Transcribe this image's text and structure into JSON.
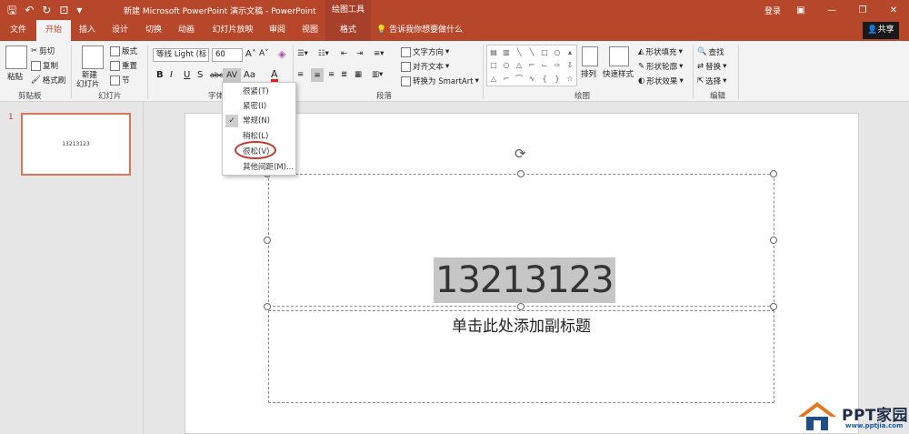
{
  "titlebar": {
    "qat_icons": [
      "save-icon",
      "undo-icon",
      "redo-icon",
      "start-from-beginning-icon",
      "customize-qat-icon"
    ],
    "title": "新建 Microsoft PowerPoint 演示文稿 - PowerPoint",
    "context_tab_title": "绘图工具",
    "login": "登录"
  },
  "tabs": [
    "文件",
    "开始",
    "插入",
    "设计",
    "切换",
    "动画",
    "幻灯片放映",
    "审阅",
    "视图",
    "格式"
  ],
  "tellme": "告诉我你想要做什么",
  "share": "共享",
  "ribbon": {
    "clipboard": {
      "paste": "粘贴",
      "cut": "剪切",
      "copy": "复制",
      "format_painter": "格式刷",
      "label": "剪贴板"
    },
    "slides": {
      "new_slide_line1": "新建",
      "new_slide_line2": "幻灯片",
      "layout": "版式",
      "reset": "重置",
      "section": "节",
      "label": "幻灯片"
    },
    "font": {
      "font_name": "等线 Light (标",
      "font_size": "60",
      "label": "字体"
    },
    "paragraph": {
      "text_direction": "文字方向",
      "align_text": "对齐文本",
      "convert_smartart": "转换为 SmartArt",
      "label": "段落"
    },
    "drawing": {
      "arrange": "排列",
      "quick_styles": "快速样式",
      "shape_fill": "形状填充",
      "shape_outline": "形状轮廓",
      "shape_effects": "形状效果",
      "label": "绘图"
    },
    "editing": {
      "find": "查找",
      "replace": "替换",
      "select": "选择",
      "label": "编辑"
    }
  },
  "spacing_menu": [
    "很紧(T)",
    "紧密(I)",
    "常规(N)",
    "稍松(L)",
    "很松(V)",
    "其他间距(M)..."
  ],
  "spacing_menu_selected": "常规(N)",
  "thumbnail": {
    "number": "1",
    "text": "13213123"
  },
  "slide": {
    "title": "13213123",
    "subtitle": "单击此处添加副标题"
  },
  "watermark": {
    "brand": "PPT家园",
    "url": "www.pptjia.com"
  }
}
